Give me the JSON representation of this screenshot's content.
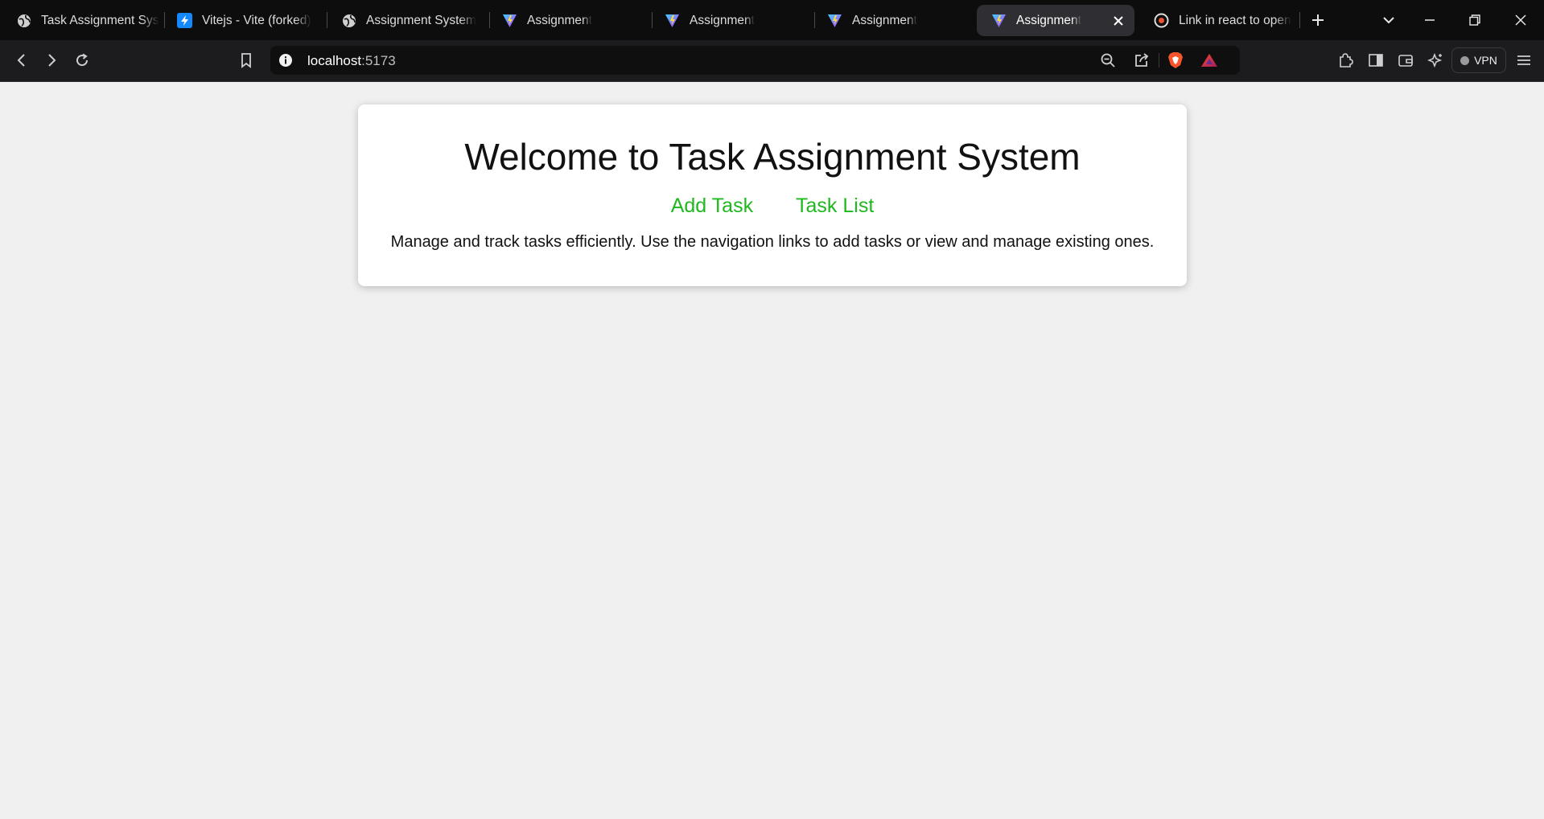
{
  "browser": {
    "tabs": [
      {
        "label": "Task Assignment System",
        "icon": "globe-icon"
      },
      {
        "label": "Vitejs - Vite (forked)",
        "icon": "stackblitz-icon"
      },
      {
        "label": "Assignment System",
        "icon": "globe-icon"
      },
      {
        "label": "Assignment",
        "icon": "vite-icon"
      },
      {
        "label": "Assignment",
        "icon": "vite-icon"
      },
      {
        "label": "Assignment",
        "icon": "vite-icon"
      },
      {
        "label": "Assignment",
        "icon": "vite-icon",
        "active": true
      },
      {
        "label": "Link in react to open",
        "icon": "stackoverflow-icon"
      }
    ],
    "url": {
      "host": "localhost",
      "port": ":5173"
    },
    "vpn_label": "VPN",
    "colors": {
      "tabbar": "#0d0d0e",
      "toolbar": "#1c1c1f",
      "active_tab": "#2f2f33",
      "brave": "#fb542b"
    }
  },
  "page": {
    "title": "Welcome to Task Assignment System",
    "nav": {
      "add_task": "Add Task",
      "task_list": "Task List"
    },
    "description": "Manage and track tasks efficiently. Use the navigation links to add tasks or view and manage existing ones.",
    "colors": {
      "background": "#f0f0f0",
      "link": "#1fb81f"
    }
  }
}
